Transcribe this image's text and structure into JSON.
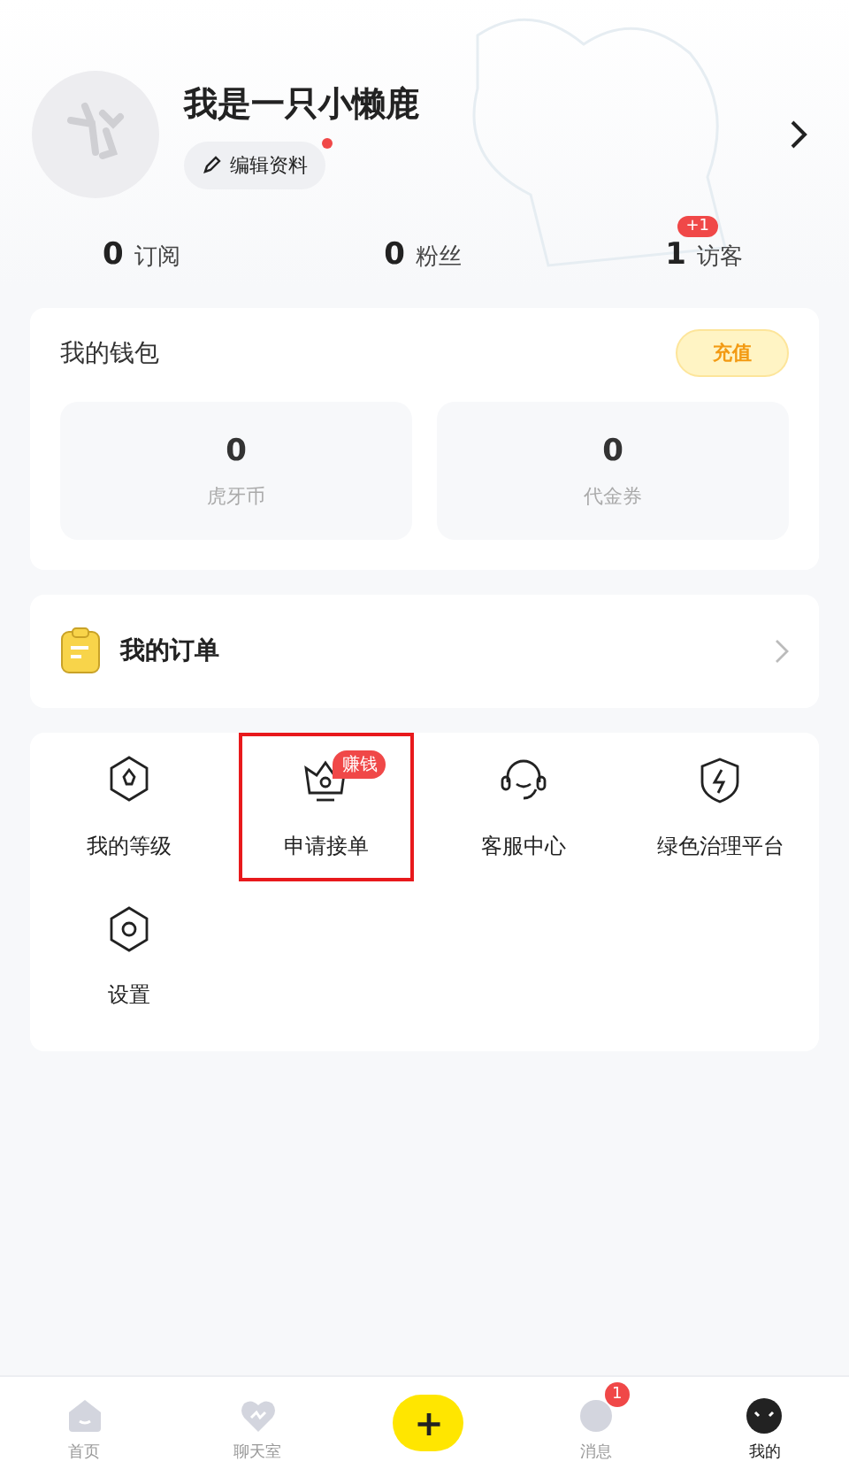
{
  "profile": {
    "name": "我是一只小懒鹿",
    "edit_button": "编辑资料",
    "edit_dot": true
  },
  "stats": [
    {
      "value": "0",
      "label": "订阅"
    },
    {
      "value": "0",
      "label": "粉丝"
    },
    {
      "value": "1",
      "label": "访客",
      "badge": "+1"
    }
  ],
  "wallet": {
    "title": "我的钱包",
    "recharge_button": "充值",
    "items": [
      {
        "value": "0",
        "label": "虎牙币"
      },
      {
        "value": "0",
        "label": "代金券"
      }
    ]
  },
  "orders": {
    "title": "我的订单"
  },
  "services": [
    {
      "kind": "level",
      "label": "我的等级",
      "highlighted": false
    },
    {
      "kind": "crown",
      "label": "申请接单",
      "badge": "赚钱",
      "highlighted": true
    },
    {
      "kind": "headset",
      "label": "客服中心",
      "highlighted": false
    },
    {
      "kind": "shield",
      "label": "绿色治理平台",
      "highlighted": false
    },
    {
      "kind": "settings",
      "label": "设置",
      "highlighted": false
    }
  ],
  "tab_bar": [
    {
      "kind": "home",
      "label": "首页",
      "selected": false
    },
    {
      "kind": "chat",
      "label": "聊天室",
      "selected": false
    },
    {
      "kind": "plus",
      "label": "+"
    },
    {
      "kind": "message",
      "label": "消息",
      "badge": "1",
      "selected": false
    },
    {
      "kind": "me",
      "label": "我的",
      "selected": true
    }
  ]
}
